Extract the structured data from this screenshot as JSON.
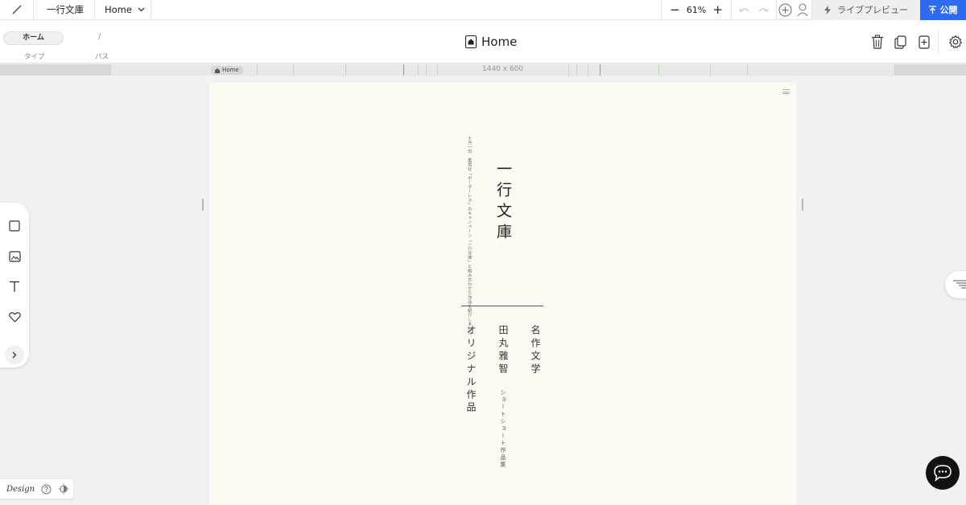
{
  "topbar": {
    "site_name": "一行文庫",
    "page_select": "Home",
    "zoom": "61%",
    "live_preview": "ライブプレビュー",
    "publish": "公開"
  },
  "subbar": {
    "type_value": "ホーム",
    "type_label": "タイプ",
    "path_value": "/",
    "path_label": "パス",
    "page_title": "Home"
  },
  "ruler": {
    "home_label": "Home",
    "size_label": "1440 x 600"
  },
  "canvas": {
    "caption": "十月一日　集英社「ボーダーレス」のキャンペーン「一行文庫」と組み合わせた作品を紹介しました",
    "title": "一行文庫",
    "menu": [
      "名作文学",
      "田丸雅智",
      "オリジナル作品"
    ],
    "menu_sub": "ショートショート作品集",
    "bg_color": "#fcfaf3"
  },
  "leftdock": {
    "icons": [
      "square-icon",
      "image-icon",
      "text-icon",
      "heart-icon",
      "chevron-right-icon"
    ]
  },
  "footer": {
    "design_label": "Design"
  },
  "colors": {
    "accent": "#2e6bf0",
    "preview_bg": "#efefef"
  }
}
